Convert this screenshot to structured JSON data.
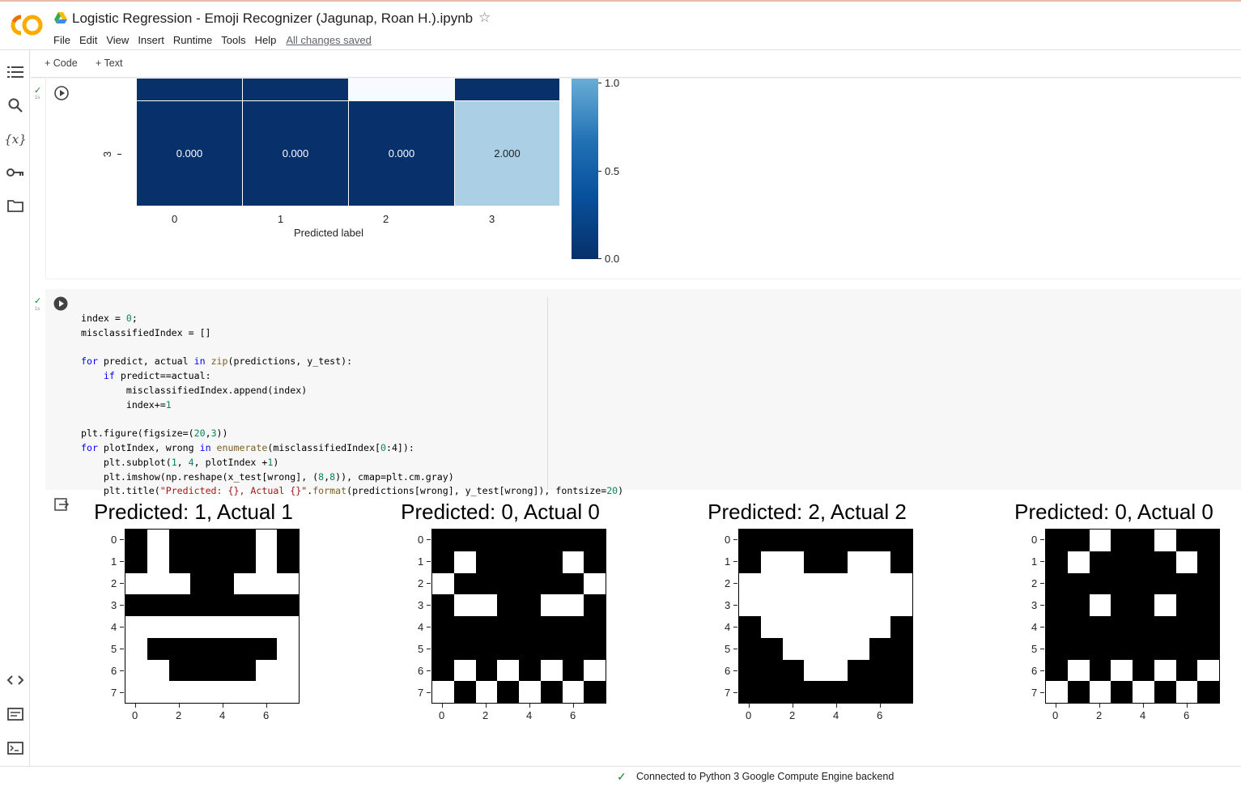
{
  "header": {
    "title": "Logistic Regression - Emoji Recognizer (Jagunap, Roan H.).ipynb",
    "logo_text": "CO",
    "menu": [
      "File",
      "Edit",
      "View",
      "Insert",
      "Runtime",
      "Tools",
      "Help"
    ],
    "saved_status": "All changes saved"
  },
  "sidebar": {
    "icons": [
      "table-of-contents-icon",
      "search-icon",
      "variables-icon",
      "secrets-key-icon",
      "files-folder-icon",
      "code-snippets-icon",
      "command-palette-icon",
      "terminal-icon"
    ],
    "variables_label": "{x}"
  },
  "toolbar": {
    "add_code": "+ Code",
    "add_text": "+ Text"
  },
  "cell1": {
    "exec_time": "1s",
    "row_label": "3",
    "values": [
      "0.000",
      "0.000",
      "0.000",
      "2.000"
    ],
    "x_ticks": [
      "0",
      "1",
      "2",
      "3"
    ],
    "xlabel": "Predicted label",
    "colorbar_ticks": [
      "1.0",
      "0.5",
      "0.0"
    ]
  },
  "cell2": {
    "exec_time": "1s",
    "code_lines": [
      "index = 0;",
      "misclassifiedIndex = []",
      "",
      "for predict, actual in zip(predictions, y_test):",
      "    if predict==actual:",
      "        misclassifiedIndex.append(index)",
      "        index+=1",
      "",
      "plt.figure(figsize=(20,3))",
      "for plotIndex, wrong in enumerate(misclassifiedIndex[0:4]):",
      "    plt.subplot(1, 4, plotIndex +1)",
      "    plt.imshow(np.reshape(x_test[wrong], (8,8)), cmap=plt.cm.gray)",
      "    plt.title(\"Predicted: {}, Actual {}\".format(predictions[wrong], y_test[wrong]), fontsize=20)"
    ]
  },
  "chart_data": [
    {
      "type": "heatmap",
      "title": "",
      "xlabel": "Predicted label",
      "ylabel": "",
      "categories": [
        "0",
        "1",
        "2",
        "3"
      ],
      "rows": [
        {
          "label": "",
          "values": [
            null,
            null,
            null,
            null
          ]
        },
        {
          "label": "3",
          "values": [
            0.0,
            0.0,
            0.0,
            2.0
          ]
        }
      ],
      "colorbar": {
        "ticks": [
          "0.0",
          "0.5",
          "1.0"
        ],
        "cmap": "Blues"
      }
    },
    {
      "type": "heatmap",
      "title": "Predicted: 1, Actual 1",
      "x_ticks": [
        "0",
        "2",
        "4",
        "6"
      ],
      "y_ticks": [
        "0",
        "1",
        "2",
        "3",
        "4",
        "5",
        "6",
        "7"
      ],
      "pixels": [
        [
          0,
          1,
          0,
          0,
          0,
          0,
          1,
          0
        ],
        [
          0,
          1,
          0,
          0,
          0,
          0,
          1,
          0
        ],
        [
          1,
          1,
          1,
          0,
          0,
          1,
          1,
          1
        ],
        [
          0,
          0,
          0,
          0,
          0,
          0,
          0,
          0
        ],
        [
          1,
          1,
          1,
          1,
          1,
          1,
          1,
          1
        ],
        [
          1,
          0,
          0,
          0,
          0,
          0,
          0,
          1
        ],
        [
          1,
          1,
          0,
          0,
          0,
          0,
          1,
          1
        ],
        [
          1,
          1,
          1,
          1,
          1,
          1,
          1,
          1
        ]
      ]
    },
    {
      "type": "heatmap",
      "title": "Predicted: 0, Actual 0",
      "x_ticks": [
        "0",
        "2",
        "4",
        "6"
      ],
      "y_ticks": [
        "0",
        "1",
        "2",
        "3",
        "4",
        "5",
        "6",
        "7"
      ],
      "pixels": [
        [
          0,
          0,
          0,
          0,
          0,
          0,
          0,
          0
        ],
        [
          0,
          1,
          0,
          0,
          0,
          0,
          1,
          0
        ],
        [
          1,
          0,
          0,
          0,
          0,
          0,
          0,
          1
        ],
        [
          0,
          1,
          1,
          0,
          0,
          1,
          1,
          0
        ],
        [
          0,
          0,
          0,
          0,
          0,
          0,
          0,
          0
        ],
        [
          0,
          0,
          0,
          0,
          0,
          0,
          0,
          0
        ],
        [
          0,
          1,
          0,
          1,
          0,
          1,
          0,
          1
        ],
        [
          1,
          0,
          1,
          0,
          1,
          0,
          1,
          0
        ]
      ]
    },
    {
      "type": "heatmap",
      "title": "Predicted: 2, Actual 2",
      "x_ticks": [
        "0",
        "2",
        "4",
        "6"
      ],
      "y_ticks": [
        "0",
        "1",
        "2",
        "3",
        "4",
        "5",
        "6",
        "7"
      ],
      "pixels": [
        [
          0,
          0,
          0,
          0,
          0,
          0,
          0,
          0
        ],
        [
          0,
          1,
          1,
          0,
          0,
          1,
          1,
          0
        ],
        [
          1,
          1,
          1,
          1,
          1,
          1,
          1,
          1
        ],
        [
          1,
          1,
          1,
          1,
          1,
          1,
          1,
          1
        ],
        [
          0,
          1,
          1,
          1,
          1,
          1,
          1,
          0
        ],
        [
          0,
          0,
          1,
          1,
          1,
          1,
          0,
          0
        ],
        [
          0,
          0,
          0,
          1,
          1,
          0,
          0,
          0
        ],
        [
          0,
          0,
          0,
          0,
          0,
          0,
          0,
          0
        ]
      ]
    },
    {
      "type": "heatmap",
      "title": "Predicted: 0, Actual 0",
      "x_ticks": [
        "0",
        "2",
        "4",
        "6"
      ],
      "y_ticks": [
        "0",
        "1",
        "2",
        "3",
        "4",
        "5",
        "6",
        "7"
      ],
      "pixels": [
        [
          0,
          0,
          1,
          0,
          0,
          1,
          0,
          0
        ],
        [
          0,
          1,
          0,
          0,
          0,
          0,
          1,
          0
        ],
        [
          0,
          0,
          0,
          0,
          0,
          0,
          0,
          0
        ],
        [
          0,
          0,
          1,
          0,
          0,
          1,
          0,
          0
        ],
        [
          0,
          0,
          0,
          0,
          0,
          0,
          0,
          0
        ],
        [
          0,
          0,
          0,
          0,
          0,
          0,
          0,
          0
        ],
        [
          0,
          1,
          0,
          1,
          0,
          1,
          0,
          1
        ],
        [
          1,
          0,
          1,
          0,
          1,
          0,
          1,
          0
        ]
      ]
    }
  ],
  "status": {
    "text": "Connected to Python 3 Google Compute Engine backend"
  },
  "colors": {
    "check_green": "#188038",
    "dark_blue": "#08306b",
    "light_blue": "#abd0e6",
    "white_cell": "#f7fbff"
  }
}
